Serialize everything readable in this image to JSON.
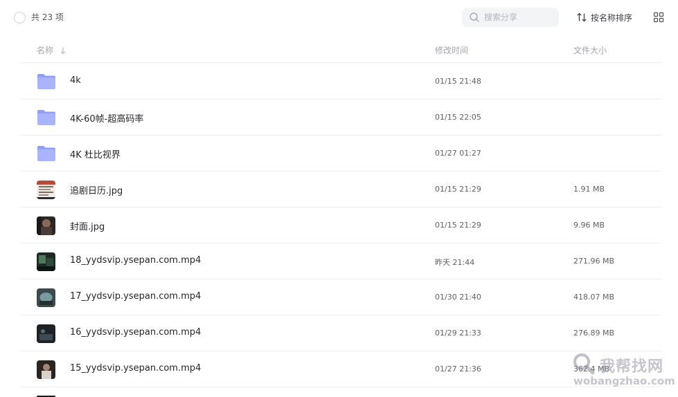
{
  "toolbar": {
    "count_label": "共 23 项",
    "search_placeholder": "搜索分享",
    "sort_label": "按名称排序"
  },
  "header": {
    "name": "名称",
    "time": "修改时间",
    "size": "文件大小"
  },
  "files": [
    {
      "name": "4k",
      "time": "01/15 21:48",
      "size": "",
      "type": "folder"
    },
    {
      "name": "4K-60帧-超高码率",
      "time": "01/15 22:05",
      "size": "",
      "type": "folder"
    },
    {
      "name": "4K 杜比视界",
      "time": "01/27 01:27",
      "size": "",
      "type": "folder"
    },
    {
      "name": "追剧日历.jpg",
      "time": "01/15 21:29",
      "size": "1.91 MB",
      "type": "image"
    },
    {
      "name": "封面.jpg",
      "time": "01/15 21:29",
      "size": "9.96 MB",
      "type": "image"
    },
    {
      "name": "18_yydsvip.ysepan.com.mp4",
      "time": "昨天 21:44",
      "size": "271.96 MB",
      "type": "video"
    },
    {
      "name": "17_yydsvip.ysepan.com.mp4",
      "time": "01/30 21:40",
      "size": "418.07 MB",
      "type": "video"
    },
    {
      "name": "16_yydsvip.ysepan.com.mp4",
      "time": "01/29 21:33",
      "size": "276.89 MB",
      "type": "video"
    },
    {
      "name": "15_yydsvip.ysepan.com.mp4",
      "time": "01/27 21:36",
      "size": "362.4 MB",
      "type": "video"
    }
  ],
  "watermark": {
    "text": "我帮找网",
    "sub": "wobangzhao.com"
  },
  "colors": {
    "folder": "#8f9dfb",
    "folder_light": "#a9b4fd",
    "divider": "#f0f1f3",
    "muted_text": "#a2a5ad"
  },
  "icons": {
    "search": "search-icon",
    "sort": "sort-icon",
    "grid": "grid-view-icon",
    "folder": "folder-icon",
    "sort_arrow": "arrow-down-icon"
  }
}
